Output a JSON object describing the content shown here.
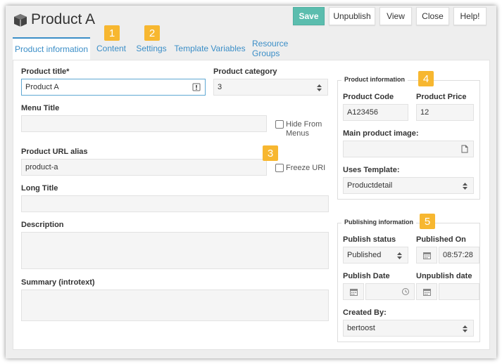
{
  "header": {
    "title": "Product A",
    "icon": "box-icon"
  },
  "toolbar": {
    "save": "Save",
    "unpublish": "Unpublish",
    "view": "View",
    "close": "Close",
    "help": "Help!"
  },
  "tabs": [
    {
      "label": "Product information",
      "active": true
    },
    {
      "label": "Content"
    },
    {
      "label": "Settings"
    },
    {
      "label": "Template Variables"
    },
    {
      "label": "Resource Groups"
    }
  ],
  "badges": [
    "1",
    "2",
    "3",
    "4",
    "5"
  ],
  "form": {
    "product_title_label": "Product title*",
    "product_title_value": "Product A",
    "product_category_label": "Product category",
    "product_category_value": "3",
    "menu_title_label": "Menu Title",
    "menu_title_value": "",
    "hide_from_menus_label": "Hide From Menus",
    "url_alias_label": "Product URL alias",
    "url_alias_value": "product-a",
    "freeze_uri_label": "Freeze URI",
    "long_title_label": "Long Title",
    "description_label": "Description",
    "summary_label": "Summary (introtext)"
  },
  "product_info": {
    "legend": "Product information",
    "code_label": "Product Code",
    "code_value": "A123456",
    "price_label": "Product Price",
    "price_value": "12",
    "image_label": "Main product image:",
    "template_label": "Uses Template:",
    "template_value": "Productdetail"
  },
  "publishing": {
    "legend": "Publishing information",
    "status_label": "Publish status",
    "status_value": "Published",
    "published_on_label": "Published On",
    "published_on_time": "08:57:28",
    "publish_date_label": "Publish Date",
    "unpublish_date_label": "Unpublish date",
    "created_by_label": "Created By:",
    "created_by_value": "bertoost"
  },
  "colors": {
    "primary": "#5bbdae",
    "link": "#3b8ec7",
    "badge": "#f7b730",
    "focus": "#5fa8d3"
  }
}
